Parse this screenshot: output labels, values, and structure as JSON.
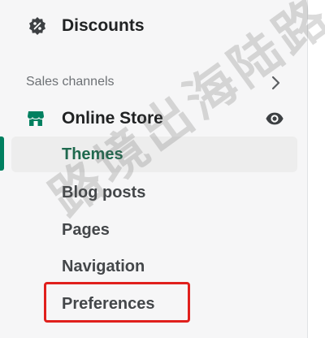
{
  "nav": {
    "discounts_label": "Discounts",
    "sales_channels_label": "Sales channels",
    "online_store_label": "Online Store",
    "sub_items": [
      {
        "label": "Themes",
        "active": true
      },
      {
        "label": "Blog posts",
        "active": false
      },
      {
        "label": "Pages",
        "active": false
      },
      {
        "label": "Navigation",
        "active": false
      },
      {
        "label": "Preferences",
        "active": false,
        "highlighted": true
      }
    ]
  },
  "icons": {
    "discounts": "discount-badge-icon",
    "sales_channels_chevron": "chevron-right-icon",
    "online_store": "storefront-icon",
    "view_store": "eye-icon"
  },
  "watermark": "路境出海陆路",
  "colors": {
    "accent_green": "#008060",
    "active_text": "#1f6a4f",
    "highlight_red": "#e0201d",
    "sidebar_bg": "#f6f6f7"
  }
}
